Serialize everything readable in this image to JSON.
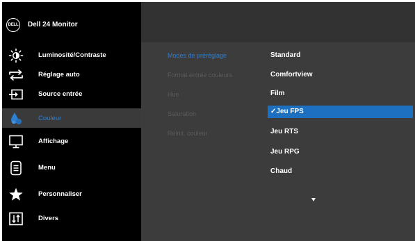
{
  "header": {
    "logo_text": "DELL",
    "title": "Dell 24 Monitor"
  },
  "menu": [
    {
      "label": "Luminosité/Contraste",
      "icon": "brightness-icon"
    },
    {
      "label": "Réglage auto",
      "icon": "auto-adjust-icon"
    },
    {
      "label": "Source entrée",
      "icon": "input-source-icon"
    },
    {
      "label": "Couleur",
      "icon": "color-icon",
      "selected": true
    },
    {
      "label": "Affichage",
      "icon": "monitor-icon"
    },
    {
      "label": "Menu",
      "icon": "menu-icon"
    },
    {
      "label": "Personnaliser",
      "icon": "star-icon"
    },
    {
      "label": "Divers",
      "icon": "others-icon"
    }
  ],
  "submenu": [
    {
      "label": "Modes de préréglage",
      "active": true
    },
    {
      "label": "Format entrée couleurs"
    },
    {
      "label": "Hue"
    },
    {
      "label": "Saturation"
    },
    {
      "label": "Réinit. couleur"
    }
  ],
  "options": [
    {
      "label": "Standard"
    },
    {
      "label": "Comfortview"
    },
    {
      "label": "Film"
    },
    {
      "label": "✓Jeu FPS",
      "selected": true
    },
    {
      "label": "Jeu RTS"
    },
    {
      "label": "Jeu RPG"
    },
    {
      "label": "Chaud"
    }
  ],
  "colors": {
    "accent": "#2f7fd0",
    "selection": "#1d6fbf",
    "panel": "#3c3c3c"
  }
}
